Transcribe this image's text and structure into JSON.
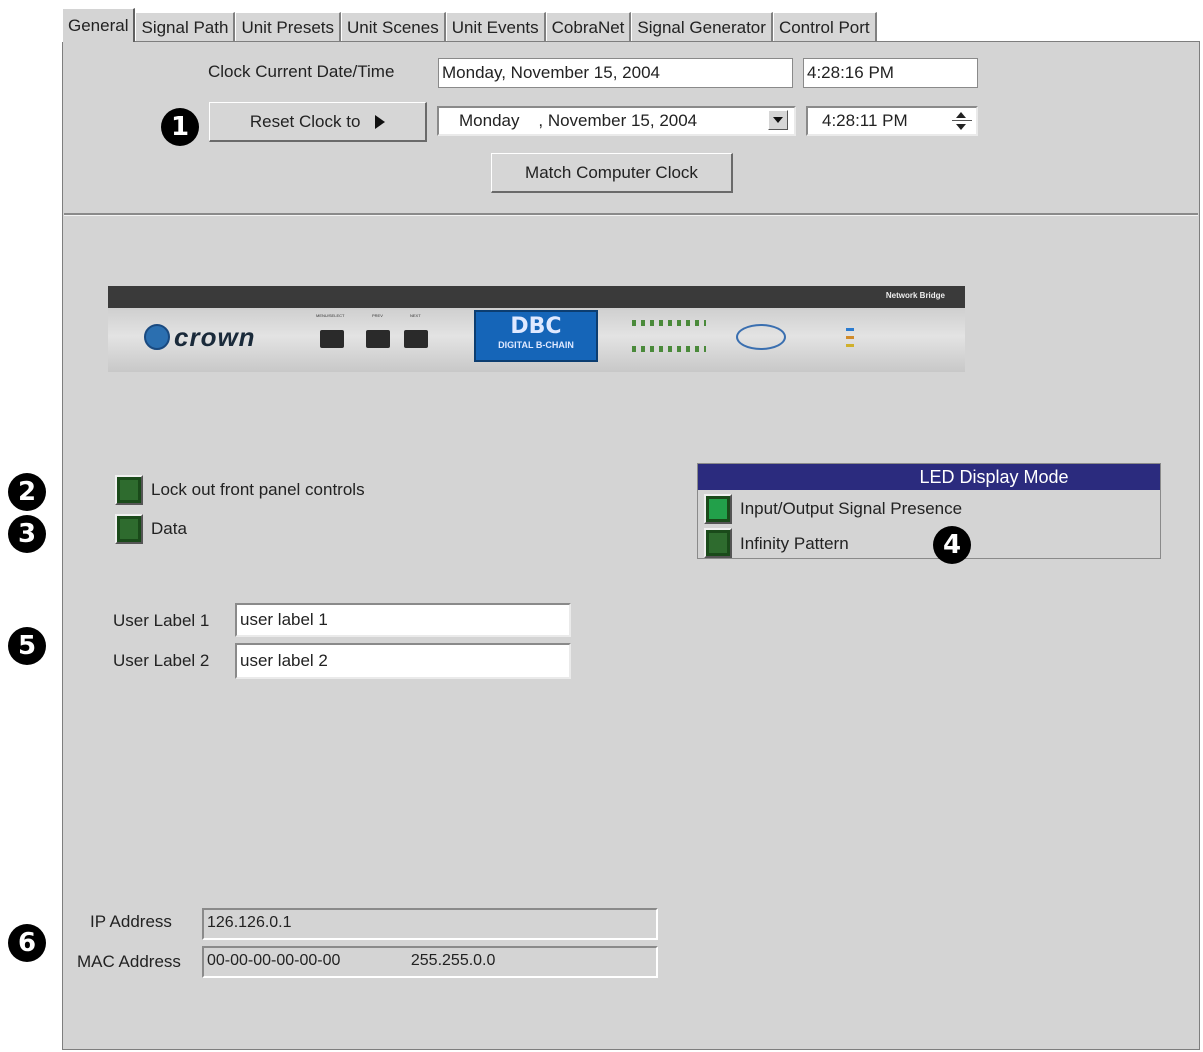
{
  "tabs": [
    "General",
    "Signal Path",
    "Unit Presets",
    "Unit Scenes",
    "Unit Events",
    "CobraNet",
    "Signal Generator",
    "Control Port"
  ],
  "clock": {
    "current_label": "Clock Current Date/Time",
    "current_date": "Monday, November 15, 2004",
    "current_time": "4:28:16 PM",
    "reset_label": "Reset Clock to",
    "reset_date": "Monday    , November 15, 2004",
    "reset_time": "4:28:11 PM",
    "match_label": "Match Computer Clock"
  },
  "device": {
    "brand": "crown",
    "tag": "Network Bridge",
    "display_top": "DBC",
    "display_bottom": "DIGITAL B-CHAIN",
    "btn_labels": [
      "MENU/SELECT",
      "PREV",
      "NEXT"
    ]
  },
  "options": {
    "lock_label": "Lock out front panel controls",
    "data_label": "Data"
  },
  "led": {
    "title": "LED Display Mode",
    "opt1": "Input/Output Signal Presence",
    "opt2": "Infinity Pattern"
  },
  "labels": {
    "label1_caption": "User Label 1",
    "label1_value": "user label 1",
    "label2_caption": "User Label 2",
    "label2_value": "user label 2"
  },
  "network": {
    "ip_label": "IP Address",
    "ip_value": "126.126.0.1",
    "mac_label": "MAC Address",
    "mac_value": "00-00-00-00-00-00",
    "mask_value": "255.255.0.0"
  },
  "bullets": [
    "1",
    "2",
    "3",
    "4",
    "5",
    "6"
  ],
  "colors": {
    "panel": "#d4d4d4",
    "led_title": "#2b2b7e",
    "checkbox_green": "#22a04a"
  }
}
